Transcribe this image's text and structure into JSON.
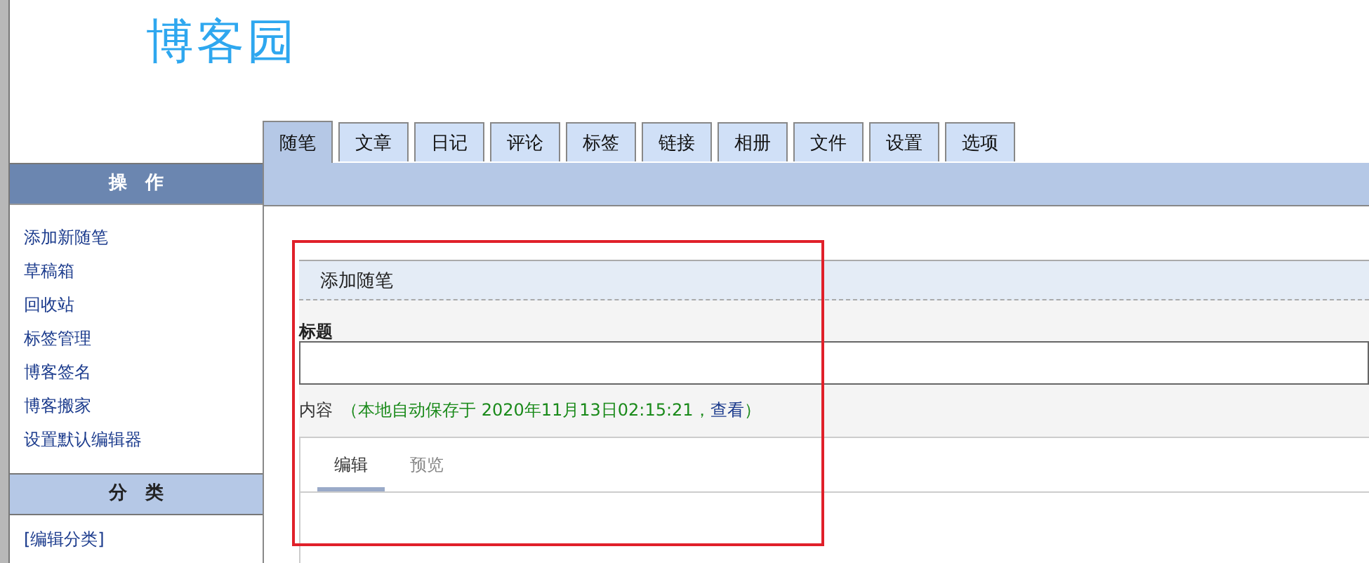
{
  "logo": {
    "text": "博客园"
  },
  "tabs": [
    {
      "label": "随笔",
      "selected": true
    },
    {
      "label": "文章",
      "selected": false
    },
    {
      "label": "日记",
      "selected": false
    },
    {
      "label": "评论",
      "selected": false
    },
    {
      "label": "标签",
      "selected": false
    },
    {
      "label": "链接",
      "selected": false
    },
    {
      "label": "相册",
      "selected": false
    },
    {
      "label": "文件",
      "selected": false
    },
    {
      "label": "设置",
      "selected": false
    },
    {
      "label": "选项",
      "selected": false
    }
  ],
  "sidebar": {
    "sections": [
      {
        "title": "操　作",
        "kind": "dark",
        "items": [
          "添加新随笔",
          "草稿箱",
          "回收站",
          "标签管理",
          "博客签名",
          "博客搬家",
          "设置默认编辑器"
        ]
      },
      {
        "title": "分　类",
        "kind": "light",
        "items": [
          "[编辑分类]"
        ]
      }
    ]
  },
  "form": {
    "title": "添加随笔",
    "title_label": "标题",
    "content_label": "内容",
    "autosave_prefix": "（本地自动保存于 2020年11月13日02:15:21，",
    "autosave_link": "查看",
    "autosave_suffix": "）",
    "editor_tabs": [
      {
        "label": "编辑",
        "selected": true
      },
      {
        "label": "预览",
        "selected": false
      }
    ]
  }
}
